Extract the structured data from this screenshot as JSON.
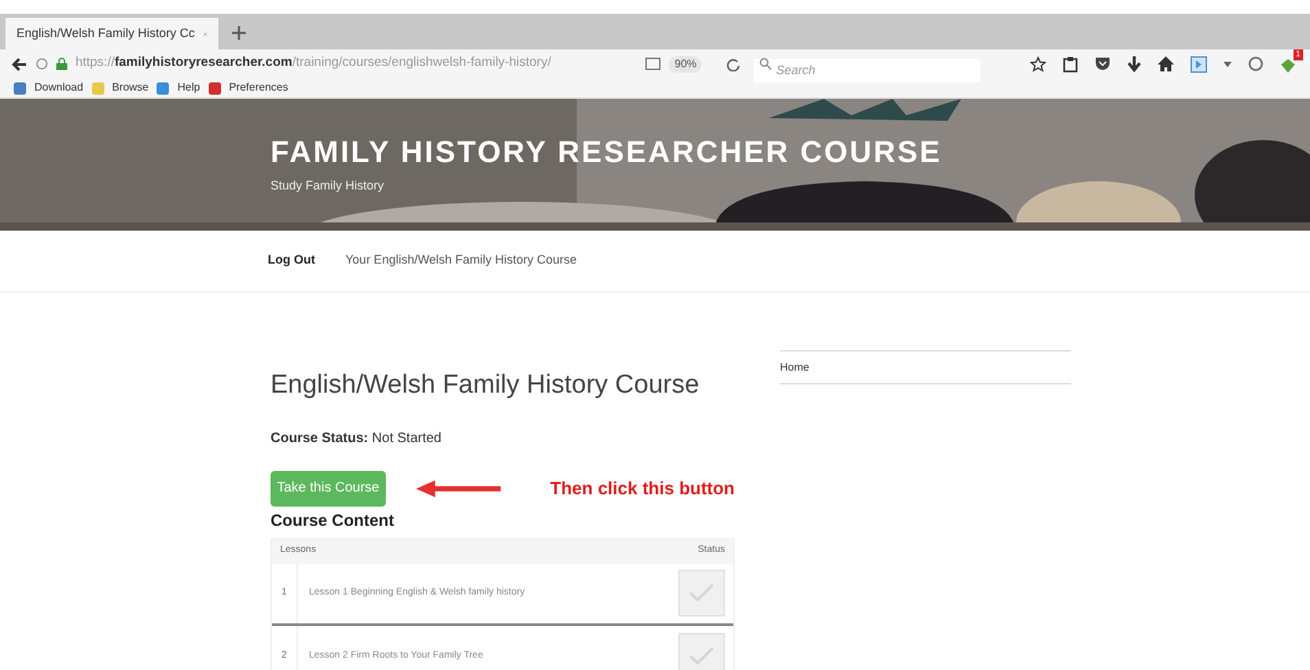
{
  "browser": {
    "tab_title": "English/Welsh Family History Cc",
    "url": "https://**familyhistoryresearcher.com**/training/courses/englishwelsh-family-history/",
    "zoom": "90%",
    "search": {
      "placeholder": "Search"
    },
    "notification_count": "1",
    "bookmarks": [
      "Download",
      "Browse",
      "Help",
      "Preferences"
    ]
  },
  "site": {
    "title": "FAMILY HISTORY RESEARCHER COURSE",
    "tagline": "Study Family History",
    "nav": [
      {
        "label": "Log Out",
        "selected": true
      },
      {
        "label": "Your English/Welsh Family History Course",
        "selected": false
      }
    ]
  },
  "page": {
    "title": "English/Welsh Family History Course",
    "status_label": "Course Status:",
    "status_value": "Not Started",
    "button": "Take this Course",
    "annotation": "Then click this button",
    "content_heading": "Course Content",
    "table": {
      "columns": [
        "Lessons",
        "Status"
      ],
      "rows": [
        {
          "number": "1",
          "lesson": "Lesson 1 Beginning English & Welsh family history",
          "completed": false
        },
        {
          "number": "2",
          "lesson": "Lesson 2 Firm Roots to Your Family Tree",
          "completed": false
        }
      ]
    }
  },
  "sidebar": {
    "items": [
      "Home"
    ]
  }
}
